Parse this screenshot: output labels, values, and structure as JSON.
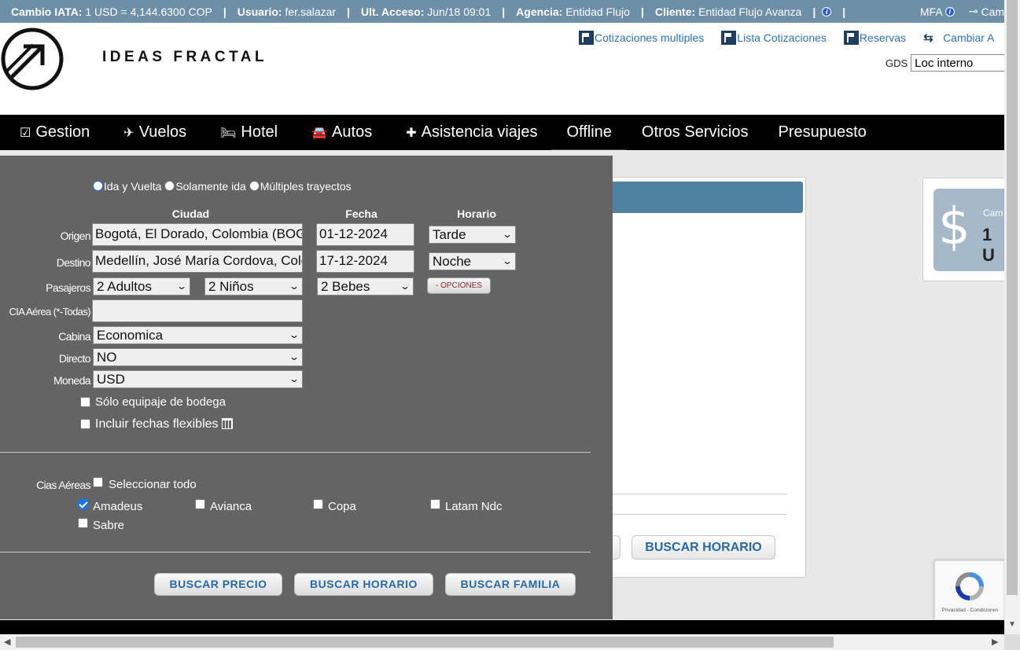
{
  "topbar": {
    "cambio_label": "Cambio IATA:",
    "cambio_value": "1 USD = 4,144.6300 COP",
    "usuario_label": "Usuario:",
    "usuario_value": "fer.salazar",
    "acceso_label": "Ult. Acceso:",
    "acceso_value": "Jun/18 09:01",
    "agencia_label": "Agencia:",
    "agencia_value": "Entidad Flujo",
    "cliente_label": "Cliente:",
    "cliente_value": "Entidad Flujo Avanza",
    "separator": "|",
    "mfa_label": "MFA",
    "cam_label": "Cam"
  },
  "header": {
    "brand": "IDEAS FRACTAL",
    "links": [
      {
        "label": "Cotizaciones multiples",
        "icon": "flag-icon"
      },
      {
        "label": "Lista Cotizaciones",
        "icon": "flag-icon"
      },
      {
        "label": "Reservas",
        "icon": "flag-icon"
      },
      {
        "label": "Cambiar A",
        "icon": "swap-icon"
      }
    ],
    "gds_label": "GDS",
    "gds_value": "Loc interno"
  },
  "nav": {
    "items": [
      {
        "label": "Gestion",
        "icon": "check-square-icon"
      },
      {
        "label": "Vuelos",
        "icon": "plane-icon"
      },
      {
        "label": "Hotel",
        "icon": "bed-icon"
      },
      {
        "label": "Autos",
        "icon": "car-icon"
      },
      {
        "label": "Asistencia viajes",
        "icon": "medkit-icon"
      },
      {
        "label": "Offline",
        "icon": ""
      },
      {
        "label": "Otros Servicios",
        "icon": ""
      },
      {
        "label": "Presupuesto",
        "icon": ""
      }
    ]
  },
  "form": {
    "trip_types": [
      "Ida y Vuelta",
      "Solamente ida",
      "Múltiples trayectos"
    ],
    "trip_selected": "Ida y Vuelta",
    "col_ciudad": "Ciudad",
    "col_fecha": "Fecha",
    "col_horario": "Horario",
    "origen_label": "Origen",
    "origen_value": "Bogotá, El Dorado, Colombia (BOG)",
    "origen_fecha": "01-12-2024",
    "origen_horario": "Tarde",
    "destino_label": "Destino",
    "destino_value": "Medellín, José María Cordova, Colombia (MDE)",
    "destino_fecha": "17-12-2024",
    "destino_horario": "Noche",
    "pasajeros_label": "Pasajeros",
    "adultos": "2 Adultos",
    "ninos": "2 Niños",
    "bebes": "2 Bebes",
    "opciones_button": "- OPCIONES",
    "cia_label": "CIA Aérea (*-Todas)",
    "cia_value": "",
    "cabina_label": "Cabina",
    "cabina_value": "Economica",
    "directo_label": "Directo",
    "directo_value": "NO",
    "moneda_label": "Moneda",
    "moneda_value": "USD",
    "solo_equipaje": "Sólo equipaje de bodega",
    "fechas_flexibles": "Incluir fechas flexibles",
    "cias_label": "Cias Aéreas",
    "seleccionar_todo": "Seleccionar todo",
    "airlines": [
      {
        "name": "Amadeus",
        "checked": true
      },
      {
        "name": "Avianca",
        "checked": false
      },
      {
        "name": "Copa",
        "checked": false
      },
      {
        "name": "Latam Ndc",
        "checked": false
      },
      {
        "name": "Sabre",
        "checked": false
      }
    ],
    "btn_precio": "BUSCAR PRECIO",
    "btn_horario": "BUSCAR HORARIO",
    "btn_familia": "BUSCAR FAMILIA"
  },
  "background": {
    "buscar_horario": "BUSCAR HORARIO",
    "rate_cam": "Cam",
    "rate_amt": "1 U",
    "rate_symbol": "$"
  },
  "recaptcha": {
    "text": "Privacidad - Condiciones"
  },
  "colors": {
    "topbar": "#6d8fa8",
    "nav": "#000000",
    "form_bg": "#646464",
    "link": "#2c72b4",
    "button_text": "#2669a8"
  }
}
